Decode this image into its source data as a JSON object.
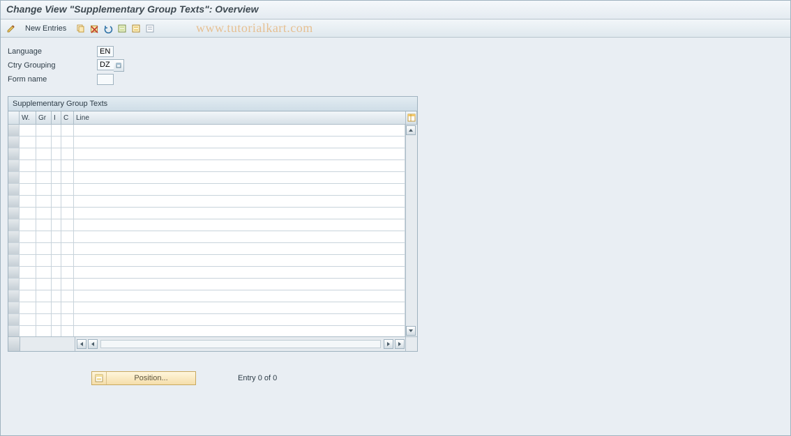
{
  "title": "Change View \"Supplementary Group Texts\": Overview",
  "watermark": "www.tutorialkart.com",
  "toolbar": {
    "pencil_tip": "Display/Change",
    "new_entries_label": "New Entries",
    "copy_tip": "Copy As...",
    "delete_tip": "Delete",
    "undo_tip": "Undo Change",
    "select_all_tip": "Select All",
    "select_block_tip": "Select Block",
    "deselect_all_tip": "Deselect All"
  },
  "form": {
    "language_label": "Language",
    "language_value": "EN",
    "ctry_grouping_label": "Ctry Grouping",
    "ctry_grouping_value": "DZ",
    "form_name_label": "Form name",
    "form_name_value": ""
  },
  "panel": {
    "title": "Supplementary Group Texts",
    "columns": {
      "w": "W.",
      "gr": "Gr",
      "i": "I",
      "c": "C",
      "line": "Line"
    }
  },
  "footer": {
    "position_label": "Position...",
    "entry_text": "Entry 0 of 0"
  }
}
